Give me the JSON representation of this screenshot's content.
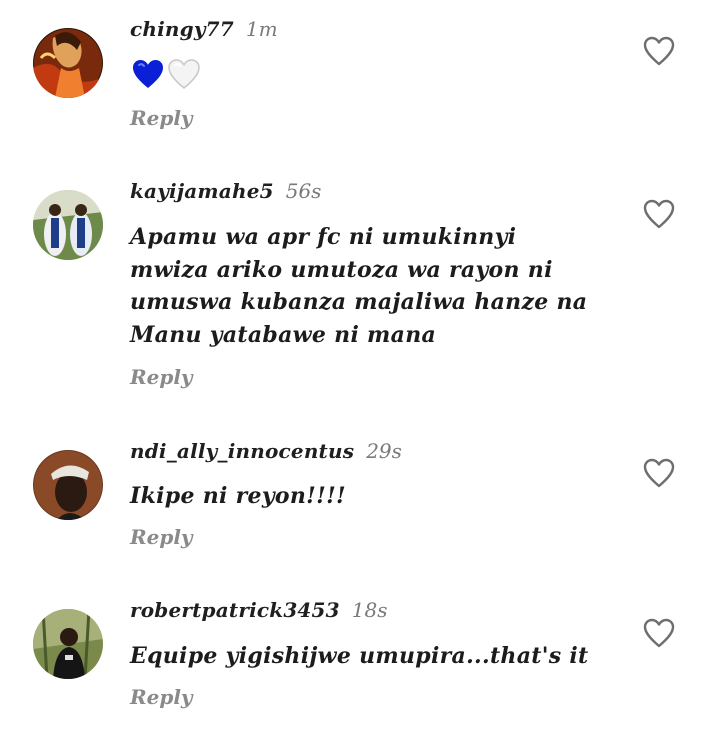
{
  "comments": [
    {
      "username": "chingy77",
      "time": "1m",
      "text": "",
      "emoji": [
        "blue-heart-icon",
        "white-heart-icon"
      ],
      "reply_label": "Reply",
      "avatar_desc": "avatar"
    },
    {
      "username": "kayijamahe5",
      "time": "56s",
      "text": "Apamu wa apr fc ni umukinnyi mwiza ariko umutoza wa rayon ni umuswa kubanza majaliwa hanze na Manu yatabawe ni mana",
      "reply_label": "Reply"
    },
    {
      "username": "ndi_ally_innocentus",
      "time": "29s",
      "text": "Ikipe ni reyon!!!!",
      "reply_label": "Reply"
    },
    {
      "username": "robertpatrick3453",
      "time": "18s",
      "text": "Equipe yigishijwe umupira...that's it",
      "reply_label": "Reply"
    }
  ],
  "colors": {
    "blue_heart": "#0a1fd6",
    "muted": "#8a8a8a",
    "text": "#1c1c1c"
  }
}
